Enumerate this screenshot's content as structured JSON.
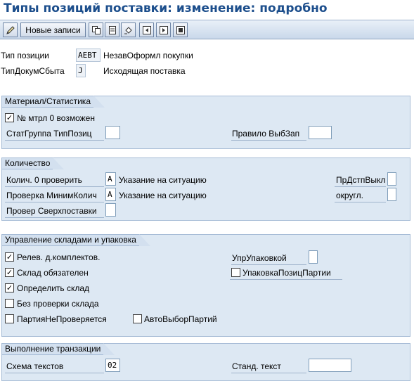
{
  "title": "Типы позиций поставки: изменение: подробно",
  "toolbar": {
    "new_entries": "Новые записи"
  },
  "header": {
    "pos_type": {
      "label": "Тип позиции",
      "value": "AEBT",
      "desc": "НезавОформл покупки"
    },
    "doc_type": {
      "label": "ТипДокумСбыта",
      "value": "J",
      "desc": "Исходящая поставка"
    }
  },
  "material": {
    "title": "Материал/Статистика",
    "mtrl0": {
      "label": "№ мтрл 0 возможен",
      "checked": true
    },
    "stat_group": {
      "label": "СтатГруппа ТипПозиц",
      "value": ""
    },
    "rule": {
      "label": "Правило ВыбЗап",
      "value": ""
    }
  },
  "quantity": {
    "title": "Количество",
    "check0": {
      "label": "Колич. 0 проверить",
      "value": "A",
      "desc": "Указание на ситуацию"
    },
    "check_min": {
      "label": "Проверка МинимКолич",
      "value": "A",
      "desc": "Указание на ситуацию"
    },
    "check_over": {
      "label": "Провер Сверхпоставки",
      "value": ""
    },
    "pr_dst": {
      "label": "ПрДстпВыкл",
      "value": ""
    },
    "round": {
      "label": "округл.",
      "value": ""
    }
  },
  "warehouse": {
    "title": "Управление складами и упаковка",
    "relev": {
      "label": "Релев. д.комплектов.",
      "checked": true
    },
    "required": {
      "label": "Склад обязателен",
      "checked": true
    },
    "determine": {
      "label": "Определить склад",
      "checked": true
    },
    "no_check": {
      "label": "Без проверки склада",
      "checked": false
    },
    "batch_nocheck": {
      "label": "ПартияНеПроверяется",
      "checked": false
    },
    "auto_batch": {
      "label": "АвтоВыборПартий",
      "checked": false
    },
    "pack_ctrl": {
      "label": "УпрУпаковкой",
      "value": ""
    },
    "pack_pos": {
      "label": "УпаковкаПозицПартии",
      "checked": false
    }
  },
  "transaction": {
    "title": "Выполнение транзакции",
    "text_scheme": {
      "label": "Схема текстов",
      "value": "02"
    },
    "std_text": {
      "label": "Станд. текст",
      "value": ""
    }
  }
}
